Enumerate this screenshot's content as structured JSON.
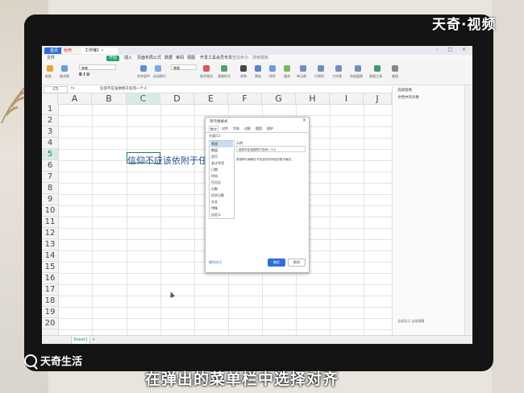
{
  "watermark": {
    "top": "天奇·视频",
    "bottom": "天奇生活"
  },
  "subtitle": "在弹出的菜单栏中选择对齐",
  "titlebar": {
    "tabs": [
      {
        "label": "首页"
      },
      {
        "label": "稻壳"
      },
      {
        "label": "工作簿1"
      }
    ],
    "close_glyph": "×",
    "window_controls": "– □ ×"
  },
  "menubar": {
    "items": [
      "文件",
      "开始",
      "插入",
      "页面布局",
      "公式",
      "数据",
      "审阅",
      "视图",
      "开发工具",
      "会员专享"
    ],
    "search_placeholder": "查找命令、搜索模板"
  },
  "ribbon": {
    "labels": [
      "粘贴",
      "格式刷",
      "宋体",
      "合并居中",
      "自动换行",
      "常规",
      "条件格式",
      "表格样式",
      "求和",
      "筛选",
      "排序",
      "填充",
      "单元格",
      "行和列",
      "工作表",
      "冻结窗格",
      "表格工具",
      "查找"
    ]
  },
  "formula_bar": {
    "name_box": "C5",
    "fx": "fx",
    "content": "信仰不应该依附于任何一个人"
  },
  "grid": {
    "columns": [
      "A",
      "B",
      "C",
      "D",
      "E",
      "F",
      "G",
      "H",
      "I",
      "J"
    ],
    "selected_column": "C",
    "rows": [
      "1",
      "2",
      "3",
      "4",
      "5",
      "6",
      "7",
      "8",
      "9",
      "10",
      "11",
      "12",
      "13",
      "14",
      "15",
      "16",
      "17",
      "18",
      "19",
      "20"
    ],
    "selected_row": "5",
    "cell_text": "信仰不应该依附于任何一"
  },
  "right_pane": {
    "title": "选择窗格",
    "item": "文档中的对象",
    "bottom": "全部显示  全部隐藏"
  },
  "sheetbar": {
    "sheet": "Sheet1",
    "add": "+"
  },
  "dialog": {
    "title": "单元格格式",
    "close": "×",
    "tabs": [
      "数字",
      "对齐",
      "字体",
      "边框",
      "图案",
      "保护"
    ],
    "active_tab": "数字",
    "category_label": "分类(C):",
    "categories": [
      "常规",
      "数值",
      "货币",
      "会计专用",
      "日期",
      "时间",
      "百分比",
      "分数",
      "科学记数",
      "文本",
      "特殊",
      "自定义"
    ],
    "selected_category": "常规",
    "sample_label": "示例",
    "sample_value": "信仰不应该依附于任何一个人",
    "description": "常规单元格格式不包含任何特定的数字格式。",
    "tips": "操作技巧",
    "ok": "确定",
    "cancel": "取消"
  }
}
